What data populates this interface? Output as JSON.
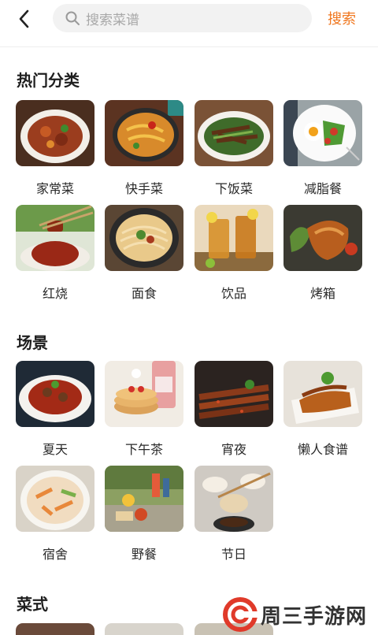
{
  "header": {
    "search_placeholder": "搜索菜谱",
    "search_button": "搜索"
  },
  "sections": [
    {
      "title": "热门分类",
      "items": [
        "家常菜",
        "快手菜",
        "下饭菜",
        "减脂餐",
        "红烧",
        "面食",
        "饮品",
        "烤箱"
      ]
    },
    {
      "title": "场景",
      "items": [
        "夏天",
        "下午茶",
        "宵夜",
        "懒人食谱",
        "宿舍",
        "野餐",
        "节日"
      ]
    },
    {
      "title": "菜式"
    }
  ],
  "watermark": {
    "text": "周三手游网"
  },
  "colors": {
    "accent": "#f0771f",
    "title": "#1e1e1e",
    "placeholder": "#a8a8a8"
  }
}
